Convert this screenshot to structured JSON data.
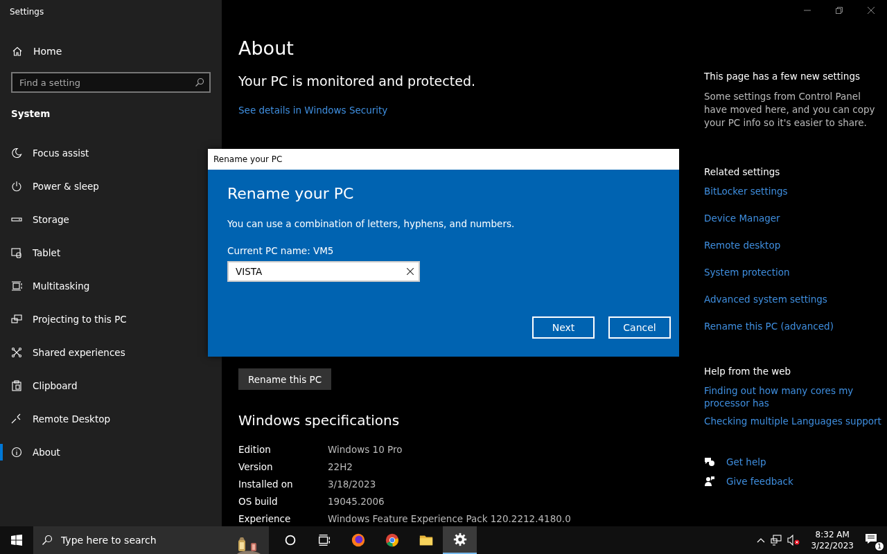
{
  "window": {
    "title": "Settings"
  },
  "sidebar": {
    "home": "Home",
    "search": {
      "placeholder": "Find a setting"
    },
    "section": "System",
    "items": [
      {
        "label": "Focus assist",
        "selected": false
      },
      {
        "label": "Power & sleep",
        "selected": false
      },
      {
        "label": "Storage",
        "selected": false
      },
      {
        "label": "Tablet",
        "selected": false
      },
      {
        "label": "Multitasking",
        "selected": false
      },
      {
        "label": "Projecting to this PC",
        "selected": false
      },
      {
        "label": "Shared experiences",
        "selected": false
      },
      {
        "label": "Clipboard",
        "selected": false
      },
      {
        "label": "Remote Desktop",
        "selected": false
      },
      {
        "label": "About",
        "selected": true
      }
    ]
  },
  "main": {
    "title": "About",
    "security": {
      "heading": "Your PC is monitored and protected.",
      "link": "See details in Windows Security"
    },
    "rename_button": "Rename this PC",
    "windows_specs": {
      "title": "Windows specifications",
      "rows": [
        {
          "label": "Edition",
          "value": "Windows 10 Pro"
        },
        {
          "label": "Version",
          "value": "22H2"
        },
        {
          "label": "Installed on",
          "value": "3/18/2023"
        },
        {
          "label": "OS build",
          "value": "19045.2006"
        },
        {
          "label": "Experience",
          "value": "Windows Feature Experience Pack 120.2212.4180.0"
        }
      ]
    }
  },
  "side_panel": {
    "notice": {
      "title": "This page has a few new settings",
      "text": "Some settings from Control Panel have moved here, and you can copy your PC info so it's easier to share."
    },
    "related": {
      "title": "Related settings",
      "links": [
        "BitLocker settings",
        "Device Manager",
        "Remote desktop",
        "System protection",
        "Advanced system settings",
        "Rename this PC (advanced)"
      ]
    },
    "help": {
      "title": "Help from the web",
      "links": [
        "Finding out how many cores my processor has",
        "Checking multiple Languages support"
      ]
    },
    "support": [
      "Get help",
      "Give feedback"
    ]
  },
  "dialog": {
    "title": "Rename your PC",
    "heading": "Rename your PC",
    "description": "You can use a combination of letters, hyphens, and numbers.",
    "current_name": "Current PC name: VM5",
    "input": {
      "value": "VISTA"
    },
    "buttons": [
      "Next",
      "Cancel"
    ]
  },
  "taskbar": {
    "search": {
      "placeholder": "Type here to search"
    },
    "apps": [
      {
        "selected": false
      },
      {
        "selected": false
      },
      {
        "selected": false
      },
      {
        "selected": false
      },
      {
        "selected": false
      },
      {
        "selected": true
      }
    ],
    "time": "8:32 AM",
    "date": "3/22/2023",
    "notification_count": "1"
  }
}
